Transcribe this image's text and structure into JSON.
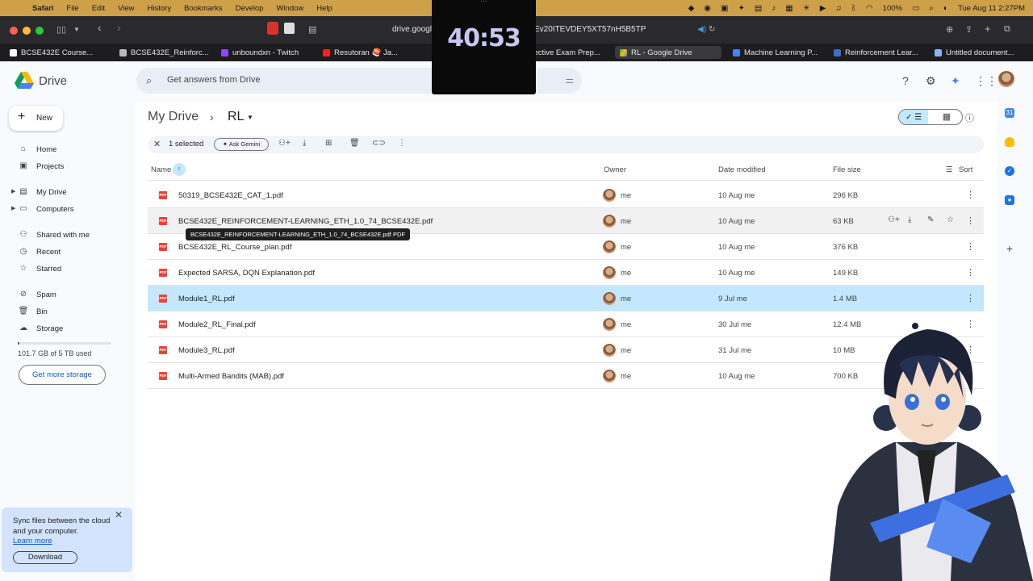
{
  "menubar": {
    "app": "Safari",
    "items": [
      "File",
      "Edit",
      "View",
      "History",
      "Bookmarks",
      "Develop",
      "Window",
      "Help"
    ],
    "battery": "100%",
    "datetime": "Tue Aug 11  2:27PM"
  },
  "browser": {
    "url_left": "drive.google",
    "url_right": "Ev20ITEVDEY5XT57nH5B5TP",
    "tabs": [
      {
        "label": "BCSE432E Course..."
      },
      {
        "label": "BCSE432E_Reinforc..."
      },
      {
        "label": "unboundxn - Twitch"
      },
      {
        "label": "Resutoran 🍣 Ja..."
      },
      {
        "label": "Effective Exam Prep..."
      },
      {
        "label": "RL - Google Drive"
      },
      {
        "label": "Machine Learning P..."
      },
      {
        "label": "Reinforcement Lear..."
      },
      {
        "label": "Untitled document..."
      }
    ]
  },
  "timer": {
    "dots": "...",
    "value": "40:53"
  },
  "header": {
    "product": "Drive",
    "search_placeholder": "Get answers from Drive"
  },
  "sidebar": {
    "new_label": "New",
    "items": [
      {
        "label": "Home",
        "icon": "home-icon"
      },
      {
        "label": "Projects",
        "icon": "projects-icon"
      },
      {
        "label": "My Drive",
        "icon": "my-drive-icon"
      },
      {
        "label": "Computers",
        "icon": "computers-icon"
      },
      {
        "label": "Shared with me",
        "icon": "shared-icon"
      },
      {
        "label": "Recent",
        "icon": "recent-icon"
      },
      {
        "label": "Starred",
        "icon": "star-icon"
      },
      {
        "label": "Spam",
        "icon": "spam-icon"
      },
      {
        "label": "Bin",
        "icon": "bin-icon"
      },
      {
        "label": "Storage",
        "icon": "cloud-icon"
      }
    ],
    "storage_text": "101.7 GB of 5 TB used",
    "storage_fraction": 0.02,
    "get_more": "Get more storage",
    "sync": {
      "text": "Sync files between the cloud and your computer.",
      "learn_more": "Learn more",
      "download": "Download"
    }
  },
  "breadcrumb": {
    "root": "My Drive",
    "current": "RL"
  },
  "selection_bar": {
    "count": "1 selected",
    "ask_gemini": "✦ Ask Gemini"
  },
  "table": {
    "headers": {
      "name": "Name",
      "owner": "Owner",
      "date": "Date modified",
      "size": "File size",
      "sort": "Sort"
    },
    "rows": [
      {
        "name": "50319_BCSE432E_CAT_1.pdf",
        "owner": "me",
        "date": "10 Aug me",
        "size": "296 KB"
      },
      {
        "name": "BCSE432E_REINFORCEMENT-LEARNING_ETH_1.0_74_BCSE432E.pdf",
        "owner": "me",
        "date": "10 Aug me",
        "size": "63 KB"
      },
      {
        "name": "BCSE432E_RL_Course_plan.pdf",
        "owner": "me",
        "date": "10 Aug me",
        "size": "376 KB"
      },
      {
        "name": "Expected SARSA, DQN Explanation.pdf",
        "owner": "me",
        "date": "10 Aug me",
        "size": "149 KB"
      },
      {
        "name": "Module1_RL.pdf",
        "owner": "me",
        "date": "9 Jul me",
        "size": "1.4 MB"
      },
      {
        "name": "Module2_RL_Final.pdf",
        "owner": "me",
        "date": "30 Jul me",
        "size": "12.4 MB"
      },
      {
        "name": "Module3_RL.pdf",
        "owner": "me",
        "date": "31 Jul me",
        "size": "10 MB"
      },
      {
        "name": "Multi-Armed Bandits (MAB).pdf",
        "owner": "me",
        "date": "10 Aug me",
        "size": "700 KB"
      }
    ],
    "tooltip": "BCSE432E_REINFORCEMENT-LEARNING_ETH_1.0_74_BCSE432E.pdf PDF",
    "file_type_badge": "PDF"
  },
  "colors": {
    "accent": "#0b57d0",
    "selected_row": "#c2e7ff",
    "menubar": "#cfa04a"
  }
}
